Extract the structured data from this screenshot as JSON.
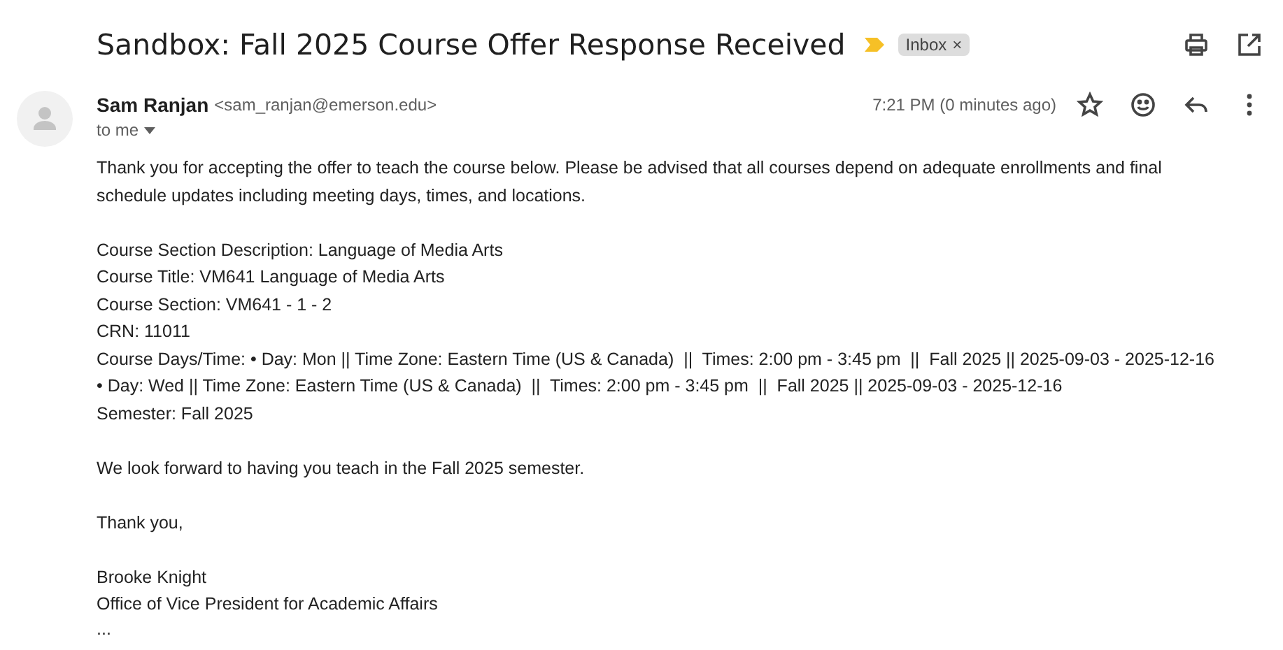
{
  "subject": "Sandbox: Fall 2025 Course Offer Response Received",
  "important": true,
  "label": {
    "text": "Inbox",
    "close": "×"
  },
  "sender": {
    "name": "Sam Ranjan",
    "email": "<sam_ranjan@emerson.edu>",
    "to": "to me",
    "time": "7:21 PM (0 minutes ago)",
    "starred": false
  },
  "paragraphs": [
    [
      "Thank you for accepting the offer to teach the course below. Please be advised that all courses depend on adequate enrollments and final",
      "schedule updates including meeting days, times, and locations."
    ],
    [
      "Course Section Description: Language of Media Arts",
      "Course Title: VM641 Language of Media Arts",
      "Course Section: VM641 - 1 - 2",
      "CRN: 11011",
      "Course Days/Time: • Day: Mon || Time Zone: Eastern Time (US & Canada)  ||  Times: 2:00 pm - 3:45 pm  ||  Fall 2025 || 2025-09-03 - 2025-12-16",
      "• Day: Wed || Time Zone: Eastern Time (US & Canada)  ||  Times: 2:00 pm - 3:45 pm  ||  Fall 2025 || 2025-09-03 - 2025-12-16",
      "Semester: Fall 2025"
    ],
    [
      "We look forward to having you teach in the Fall 2025 semester."
    ],
    [
      "Thank you,"
    ],
    [
      "Brooke Knight",
      "Office of Vice President for Academic Affairs"
    ]
  ],
  "trimmed": "..."
}
